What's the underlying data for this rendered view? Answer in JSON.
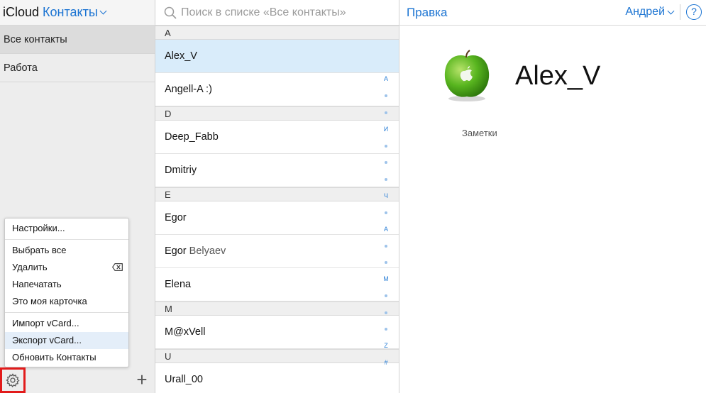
{
  "sidebar": {
    "brand": "iCloud",
    "app": "Контакты",
    "groups": [
      {
        "label": "Все контакты"
      },
      {
        "label": "Работа"
      }
    ]
  },
  "menu": {
    "items": [
      {
        "label": "Настройки..."
      },
      {
        "label": "Выбрать все"
      },
      {
        "label": "Удалить"
      },
      {
        "label": "Напечатать"
      },
      {
        "label": "Это моя карточка"
      },
      {
        "label": "Импорт vCard..."
      },
      {
        "label": "Экспорт vCard..."
      },
      {
        "label": "Обновить Контакты"
      }
    ]
  },
  "search": {
    "placeholder": "Поиск в списке «Все контакты»"
  },
  "sections": [
    {
      "letter": "A",
      "contacts": [
        {
          "first": "Alex_V",
          "last": ""
        },
        {
          "first": "Angell-A :)",
          "last": ""
        }
      ]
    },
    {
      "letter": "D",
      "contacts": [
        {
          "first": "Deep_Fabb",
          "last": ""
        },
        {
          "first": "Dmitriy",
          "last": ""
        }
      ]
    },
    {
      "letter": "E",
      "contacts": [
        {
          "first": "Egor",
          "last": ""
        },
        {
          "first": "Egor",
          "last": "Belyaev"
        },
        {
          "first": "Elena",
          "last": ""
        }
      ]
    },
    {
      "letter": "M",
      "contacts": [
        {
          "first": "M@xVell",
          "last": ""
        }
      ]
    },
    {
      "letter": "U",
      "contacts": [
        {
          "first": "Urall_00",
          "last": ""
        }
      ]
    }
  ],
  "index": [
    "A",
    "•",
    "•",
    "И",
    "•",
    "•",
    "•",
    "Ч",
    "•",
    "А",
    "•",
    "•",
    "М",
    "•",
    "•",
    "•",
    "Z",
    "#"
  ],
  "detail": {
    "edit": "Правка",
    "user": "Андрей",
    "help": "?",
    "name": "Alex_V",
    "notes_label": "Заметки"
  },
  "colors": {
    "accent": "#1a73d2",
    "selected_row": "#d9ecfa",
    "highlight_box": "#e21b1b"
  }
}
